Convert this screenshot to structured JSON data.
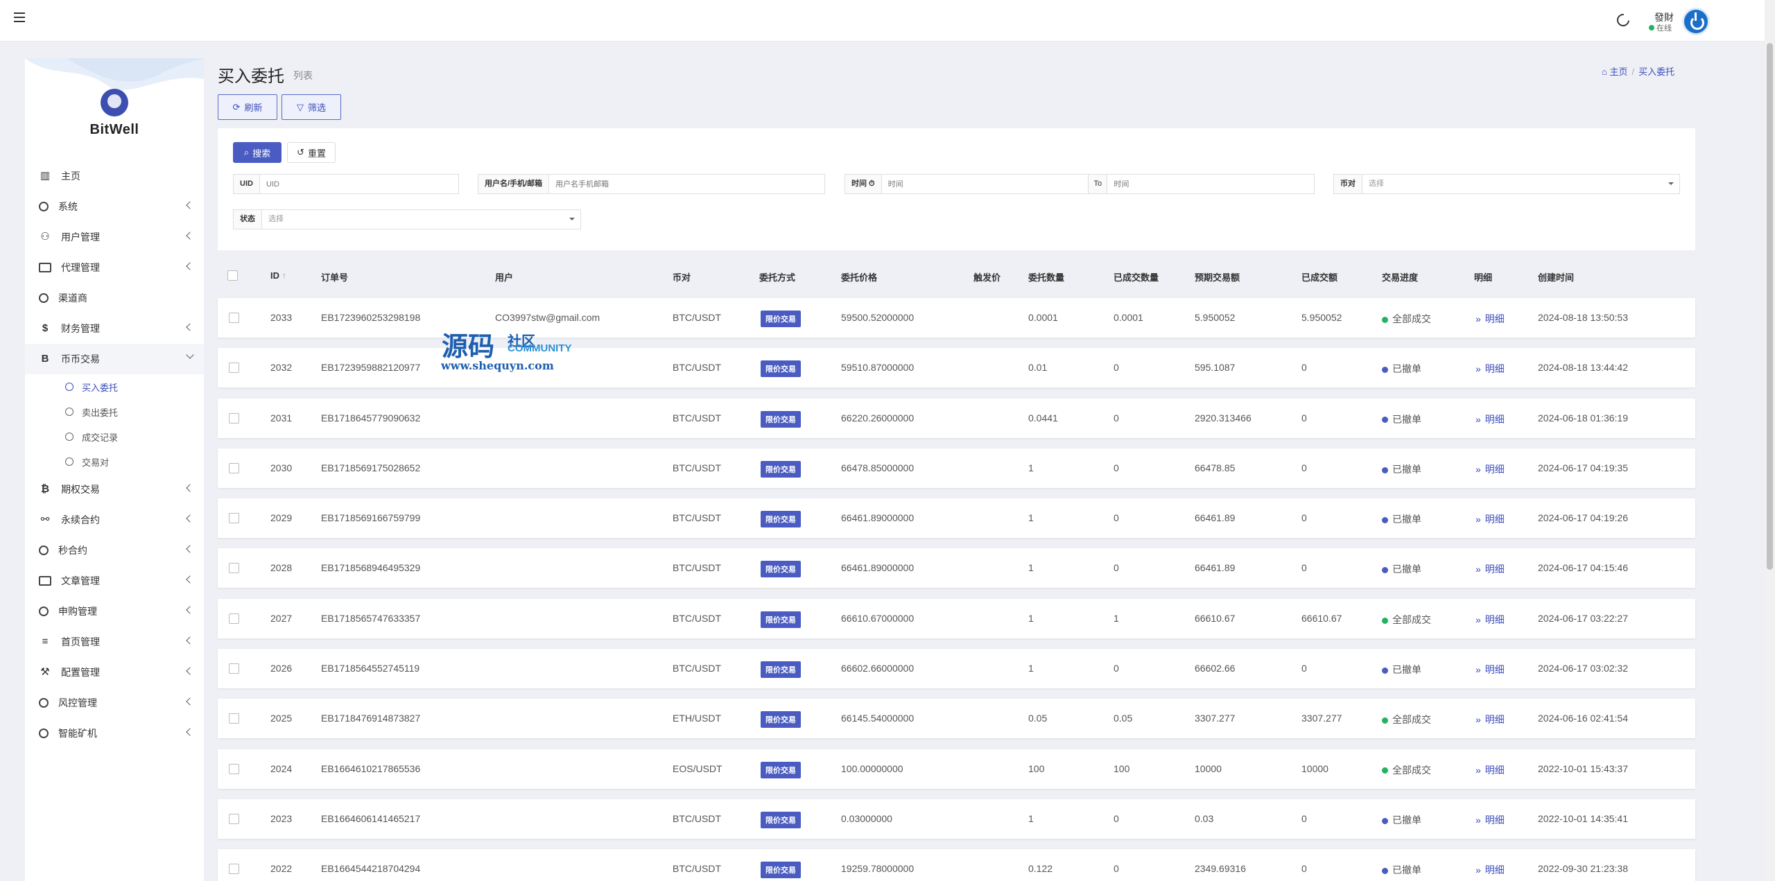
{
  "topbar": {
    "user_name": "發財",
    "user_status": "在线"
  },
  "brand": {
    "name": "BitWell"
  },
  "menu": {
    "items": [
      {
        "key": "home",
        "label": "主页",
        "icon": "chart-icon",
        "expand": false
      },
      {
        "key": "system",
        "label": "系统",
        "icon": "gear-icon",
        "expand": true
      },
      {
        "key": "users",
        "label": "用户管理",
        "icon": "user-icon",
        "expand": true
      },
      {
        "key": "agents",
        "label": "代理管理",
        "icon": "id-card-icon",
        "expand": true
      },
      {
        "key": "channel",
        "label": "渠道商",
        "icon": "person-circle-icon",
        "expand": false
      },
      {
        "key": "finance",
        "label": "财务管理",
        "icon": "dollar-icon",
        "expand": true
      },
      {
        "key": "coin",
        "label": "币币交易",
        "icon": "bitcoin-b-icon",
        "expand": true,
        "active": true
      }
    ],
    "subitems": [
      "买入委托",
      "卖出委托",
      "成交记录",
      "交易对"
    ],
    "items2": [
      {
        "key": "options",
        "label": "期权交易",
        "icon": "bitcoin-icon"
      },
      {
        "key": "perp",
        "label": "永续合约",
        "icon": "link-icon"
      },
      {
        "key": "seconds",
        "label": "秒合约",
        "icon": "target-icon"
      },
      {
        "key": "articles",
        "label": "文章管理",
        "icon": "newspaper-icon"
      },
      {
        "key": "subscribe",
        "label": "申购管理",
        "icon": "life-ring-icon"
      },
      {
        "key": "homepage",
        "label": "首页管理",
        "icon": "list-icon"
      },
      {
        "key": "config",
        "label": "配置管理",
        "icon": "wrench-icon"
      },
      {
        "key": "risk",
        "label": "风控管理",
        "icon": "circle-icon"
      },
      {
        "key": "mining",
        "label": "智能矿机",
        "icon": "circle-icon"
      }
    ]
  },
  "page": {
    "title": "买入委托",
    "subtitle": "列表",
    "breadcrumb_home": "主页",
    "breadcrumb_current": "买入委托",
    "refresh": "刷新",
    "filter": "筛选"
  },
  "search": {
    "search_btn": "搜索",
    "reset_btn": "重置",
    "uid_label": "UID",
    "uid_placeholder": "UID",
    "user_label": "用户名/手机/邮箱",
    "user_placeholder": "用户名手机邮箱",
    "time_label": "时间 ⏱",
    "time_placeholder_from": "时间",
    "to": "To",
    "time_placeholder_to": "时间",
    "pair_label": "币对",
    "pair_select": "选择",
    "status_label": "状态",
    "status_select": "选择"
  },
  "table": {
    "headers": {
      "id": "ID",
      "order": "订单号",
      "user": "用户",
      "pair": "币对",
      "method": "委托方式",
      "price": "委托价格",
      "trigger": "触发价",
      "qty": "委托数量",
      "filled_qty": "已成交数量",
      "expected": "预期交易额",
      "filled_amt": "已成交额",
      "progress": "交易进度",
      "detail": "明细",
      "created": "创建时间"
    },
    "rows": [
      {
        "id": "2033",
        "order": "EB1723960253298198",
        "user": "CO3997stw@gmail.com",
        "pair": "BTC/USDT",
        "method": "限价交易",
        "price": "59500.52000000",
        "trigger": "",
        "qty": "0.0001",
        "filled_qty": "0.0001",
        "expected": "5.950052",
        "filled_amt": "5.950052",
        "progress": "全部成交",
        "progress_color": "#22b35e",
        "detail": "明细",
        "created": "2024-08-18 13:50:53"
      },
      {
        "id": "2032",
        "order": "EB1723959882120977",
        "user": "",
        "pair": "BTC/USDT",
        "method": "限价交易",
        "price": "59510.87000000",
        "trigger": "",
        "qty": "0.01",
        "filled_qty": "0",
        "expected": "595.1087",
        "filled_amt": "0",
        "progress": "已撤单",
        "progress_color": "#4a5cc2",
        "detail": "明细",
        "created": "2024-08-18 13:44:42"
      },
      {
        "id": "2031",
        "order": "EB1718645779090632",
        "user": "",
        "pair": "BTC/USDT",
        "method": "限价交易",
        "price": "66220.26000000",
        "trigger": "",
        "qty": "0.0441",
        "filled_qty": "0",
        "expected": "2920.313466",
        "filled_amt": "0",
        "progress": "已撤单",
        "progress_color": "#4a5cc2",
        "detail": "明细",
        "created": "2024-06-18 01:36:19"
      },
      {
        "id": "2030",
        "order": "EB1718569175028652",
        "user": "",
        "pair": "BTC/USDT",
        "method": "限价交易",
        "price": "66478.85000000",
        "trigger": "",
        "qty": "1",
        "filled_qty": "0",
        "expected": "66478.85",
        "filled_amt": "0",
        "progress": "已撤单",
        "progress_color": "#4a5cc2",
        "detail": "明细",
        "created": "2024-06-17 04:19:35"
      },
      {
        "id": "2029",
        "order": "EB1718569166759799",
        "user": "",
        "pair": "BTC/USDT",
        "method": "限价交易",
        "price": "66461.89000000",
        "trigger": "",
        "qty": "1",
        "filled_qty": "0",
        "expected": "66461.89",
        "filled_amt": "0",
        "progress": "已撤单",
        "progress_color": "#4a5cc2",
        "detail": "明细",
        "created": "2024-06-17 04:19:26"
      },
      {
        "id": "2028",
        "order": "EB1718568946495329",
        "user": "",
        "pair": "BTC/USDT",
        "method": "限价交易",
        "price": "66461.89000000",
        "trigger": "",
        "qty": "1",
        "filled_qty": "0",
        "expected": "66461.89",
        "filled_amt": "0",
        "progress": "已撤单",
        "progress_color": "#4a5cc2",
        "detail": "明细",
        "created": "2024-06-17 04:15:46"
      },
      {
        "id": "2027",
        "order": "EB1718565747633357",
        "user": "",
        "pair": "BTC/USDT",
        "method": "限价交易",
        "price": "66610.67000000",
        "trigger": "",
        "qty": "1",
        "filled_qty": "1",
        "expected": "66610.67",
        "filled_amt": "66610.67",
        "progress": "全部成交",
        "progress_color": "#22b35e",
        "detail": "明细",
        "created": "2024-06-17 03:22:27"
      },
      {
        "id": "2026",
        "order": "EB1718564552745119",
        "user": "",
        "pair": "BTC/USDT",
        "method": "限价交易",
        "price": "66602.66000000",
        "trigger": "",
        "qty": "1",
        "filled_qty": "0",
        "expected": "66602.66",
        "filled_amt": "0",
        "progress": "已撤单",
        "progress_color": "#4a5cc2",
        "detail": "明细",
        "created": "2024-06-17 03:02:32"
      },
      {
        "id": "2025",
        "order": "EB1718476914873827",
        "user": "",
        "pair": "ETH/USDT",
        "method": "限价交易",
        "price": "66145.54000000",
        "trigger": "",
        "qty": "0.05",
        "filled_qty": "0.05",
        "expected": "3307.277",
        "filled_amt": "3307.277",
        "progress": "全部成交",
        "progress_color": "#22b35e",
        "detail": "明细",
        "created": "2024-06-16 02:41:54"
      },
      {
        "id": "2024",
        "order": "EB1664610217865536",
        "user": "",
        "pair": "EOS/USDT",
        "method": "限价交易",
        "price": "100.00000000",
        "trigger": "",
        "qty": "100",
        "filled_qty": "100",
        "expected": "10000",
        "filled_amt": "10000",
        "progress": "全部成交",
        "progress_color": "#22b35e",
        "detail": "明细",
        "created": "2022-10-01 15:43:37"
      },
      {
        "id": "2023",
        "order": "EB1664606141465217",
        "user": "",
        "pair": "BTC/USDT",
        "method": "限价交易",
        "price": "0.03000000",
        "trigger": "",
        "qty": "1",
        "filled_qty": "0",
        "expected": "0.03",
        "filled_amt": "0",
        "progress": "已撤单",
        "progress_color": "#4a5cc2",
        "detail": "明细",
        "created": "2022-10-01 14:35:41"
      },
      {
        "id": "2022",
        "order": "EB1664544218704294",
        "user": "",
        "pair": "BTC/USDT",
        "method": "限价交易",
        "price": "19259.78000000",
        "trigger": "",
        "qty": "0.122",
        "filled_qty": "0",
        "expected": "2349.69316",
        "filled_amt": "0",
        "progress": "已撤单",
        "progress_color": "#4a5cc2",
        "detail": "明细",
        "created": "2022-09-30 21:23:38"
      }
    ]
  },
  "watermark": {
    "line1": "源码",
    "line2": "社区",
    "line3": "COMMUNITY",
    "line4": "www.shequyn.com"
  }
}
